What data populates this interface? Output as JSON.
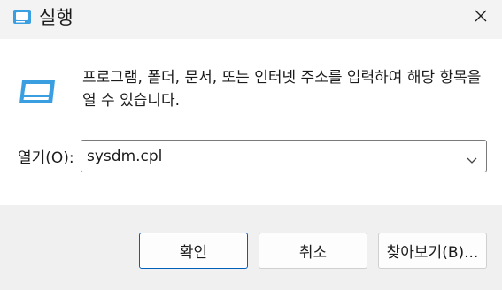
{
  "window": {
    "title": "실행",
    "close_glyph": "close-icon"
  },
  "main": {
    "description": "프로그램, 폴더, 문서, 또는 인터넷 주소를 입력하여 해당 항목을 열 수 있습니다.",
    "open_label": "열기(O):",
    "open_value": "sysdm.cpl"
  },
  "buttons": {
    "ok": "확인",
    "cancel": "취소",
    "browse": "찾아보기(B)..."
  },
  "colors": {
    "accent": "#005fb8",
    "run_icon": "#3a9fe0"
  }
}
